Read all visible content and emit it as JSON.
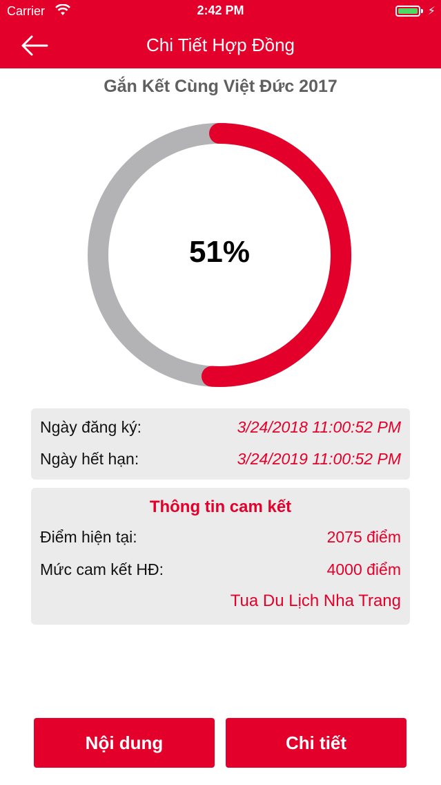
{
  "status_bar": {
    "carrier": "Carrier",
    "time": "2:42 PM"
  },
  "nav": {
    "title": "Chi Tiết Hợp Đồng"
  },
  "contract": {
    "name": "Gắn Kết Cùng Việt Đức 2017",
    "progress_percent": 51,
    "progress_label": "51%"
  },
  "dates": {
    "register_label": "Ngày đăng ký:",
    "register_value": "3/24/2018 11:00:52 PM",
    "expire_label": "Ngày hết hạn:",
    "expire_value": "3/24/2019 11:00:52 PM"
  },
  "commitment": {
    "title": "Thông tin cam kết",
    "current_label": "Điểm hiện tại:",
    "current_value": "2075 điểm",
    "target_label": "Mức cam kết HĐ:",
    "target_value": "4000 điểm",
    "reward": "Tua Du Lịch Nha Trang"
  },
  "buttons": {
    "content": "Nội dung",
    "detail": "Chi tiết"
  },
  "colors": {
    "accent": "#e3002b",
    "ring_track": "#b3b3b5",
    "panel": "#ebebeb"
  },
  "icons": {
    "back": "arrow-left-icon",
    "wifi": "wifi-icon",
    "battery": "battery-icon",
    "charging": "bolt-icon"
  }
}
